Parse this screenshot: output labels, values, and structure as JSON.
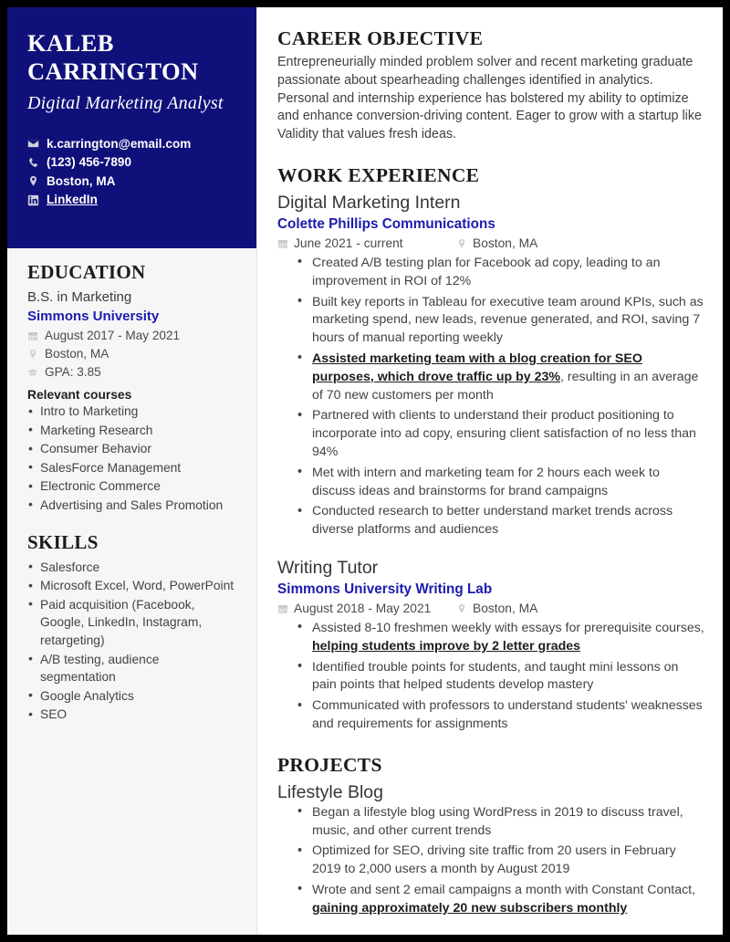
{
  "theme": {
    "navy": "#10107a",
    "accent_blue": "#1c1cad",
    "sidebar_bg": "#f6f6f7",
    "text": "#434347",
    "page_border": "#000000"
  },
  "sidebar": {
    "name_line_1": "KALEB",
    "name_line_2": "CARRINGTON",
    "job_title": "Digital Marketing Analyst",
    "contacts": [
      {
        "icon": "envelope-icon",
        "label": "k.carrington@email.com",
        "underline": false
      },
      {
        "icon": "phone-icon",
        "label": "(123) 456-7890",
        "underline": false
      },
      {
        "icon": "location-pin-icon",
        "label": "Boston, MA",
        "underline": false
      },
      {
        "icon": "linkedin-icon",
        "label": "LinkedIn",
        "underline": true
      }
    ],
    "education": {
      "heading": "EDUCATION",
      "degree": "B.S. in Marketing",
      "school": "Simmons University",
      "meta": [
        {
          "icon": "calendar-icon",
          "label": "August 2017 - May 2021"
        },
        {
          "icon": "location-pin-icon",
          "label": "Boston, MA"
        },
        {
          "icon": "graduation-cap-icon",
          "label": "GPA: 3.85"
        }
      ],
      "courses_heading": "Relevant courses",
      "courses": [
        "Intro to Marketing",
        "Marketing Research",
        "Consumer Behavior",
        "SalesForce Management",
        "Electronic Commerce",
        "Advertising and Sales Promotion"
      ]
    },
    "skills": {
      "heading": "SKILLS",
      "items": [
        "Salesforce",
        "Microsoft Excel, Word, PowerPoint",
        "Paid acquisition (Facebook, Google, LinkedIn, Instagram, retargeting)",
        "A/B testing, audience segmentation",
        "Google Analytics",
        "SEO"
      ]
    }
  },
  "main": {
    "objective": {
      "heading": "CAREER OBJECTIVE",
      "text": "Entrepreneurially minded problem solver and recent marketing graduate passionate about spearheading challenges identified in analytics. Personal and internship experience has bolstered my ability to optimize and enhance conversion-driving content. Eager to grow with a startup like Validity that values fresh ideas."
    },
    "work": {
      "heading": "WORK EXPERIENCE",
      "jobs": [
        {
          "role": "Digital Marketing Intern",
          "org": "Colette Phillips Communications",
          "dates": "June 2021 - current",
          "location": "Boston, MA",
          "bullets": [
            {
              "pre": "Created A/B testing plan for Facebook ad copy, leading to an improvement in ROI of 12%",
              "strong": "",
              "post": ""
            },
            {
              "pre": "Built key reports in Tableau for executive team around KPIs, such as marketing spend, new leads, revenue generated, and ROI, saving 7 hours of manual reporting weekly",
              "strong": "",
              "post": ""
            },
            {
              "pre": "",
              "strong": "Assisted marketing team with a blog creation for SEO purposes, which drove traffic up by 23%",
              "post": ", resulting in an average of 70 new customers per month"
            },
            {
              "pre": "Partnered with clients to understand their product positioning to incorporate into ad copy, ensuring client satisfaction of no less than 94%",
              "strong": "",
              "post": ""
            },
            {
              "pre": "Met with intern and marketing team for 2 hours each week to discuss ideas and brainstorms for brand campaigns",
              "strong": "",
              "post": ""
            },
            {
              "pre": "Conducted research to better understand market trends across diverse platforms and audiences",
              "strong": "",
              "post": ""
            }
          ]
        },
        {
          "role": "Writing Tutor",
          "org": "Simmons University Writing Lab",
          "dates": "August 2018 - May 2021",
          "location": "Boston, MA",
          "bullets": [
            {
              "pre": "Assisted 8-10 freshmen weekly with essays for prerequisite courses, ",
              "strong": "helping students improve by 2 letter grades",
              "post": ""
            },
            {
              "pre": "Identified trouble points for students, and taught mini lessons on pain points that helped students develop mastery",
              "strong": "",
              "post": ""
            },
            {
              "pre": "Communicated with professors to understand students' weaknesses and requirements for assignments",
              "strong": "",
              "post": ""
            }
          ]
        }
      ]
    },
    "projects": {
      "heading": "PROJECTS",
      "items": [
        {
          "title": "Lifestyle Blog",
          "bullets": [
            {
              "pre": "Began a lifestyle blog using WordPress in 2019 to discuss travel, music, and other current trends",
              "strong": "",
              "post": ""
            },
            {
              "pre": "Optimized for SEO, driving site traffic from 20 users in February 2019 to 2,000 users a month by August 2019",
              "strong": "",
              "post": ""
            },
            {
              "pre": "Wrote and sent 2 email campaigns a month with Constant Contact, ",
              "strong": "gaining approximately 20 new subscribers monthly",
              "post": ""
            }
          ]
        }
      ]
    }
  }
}
